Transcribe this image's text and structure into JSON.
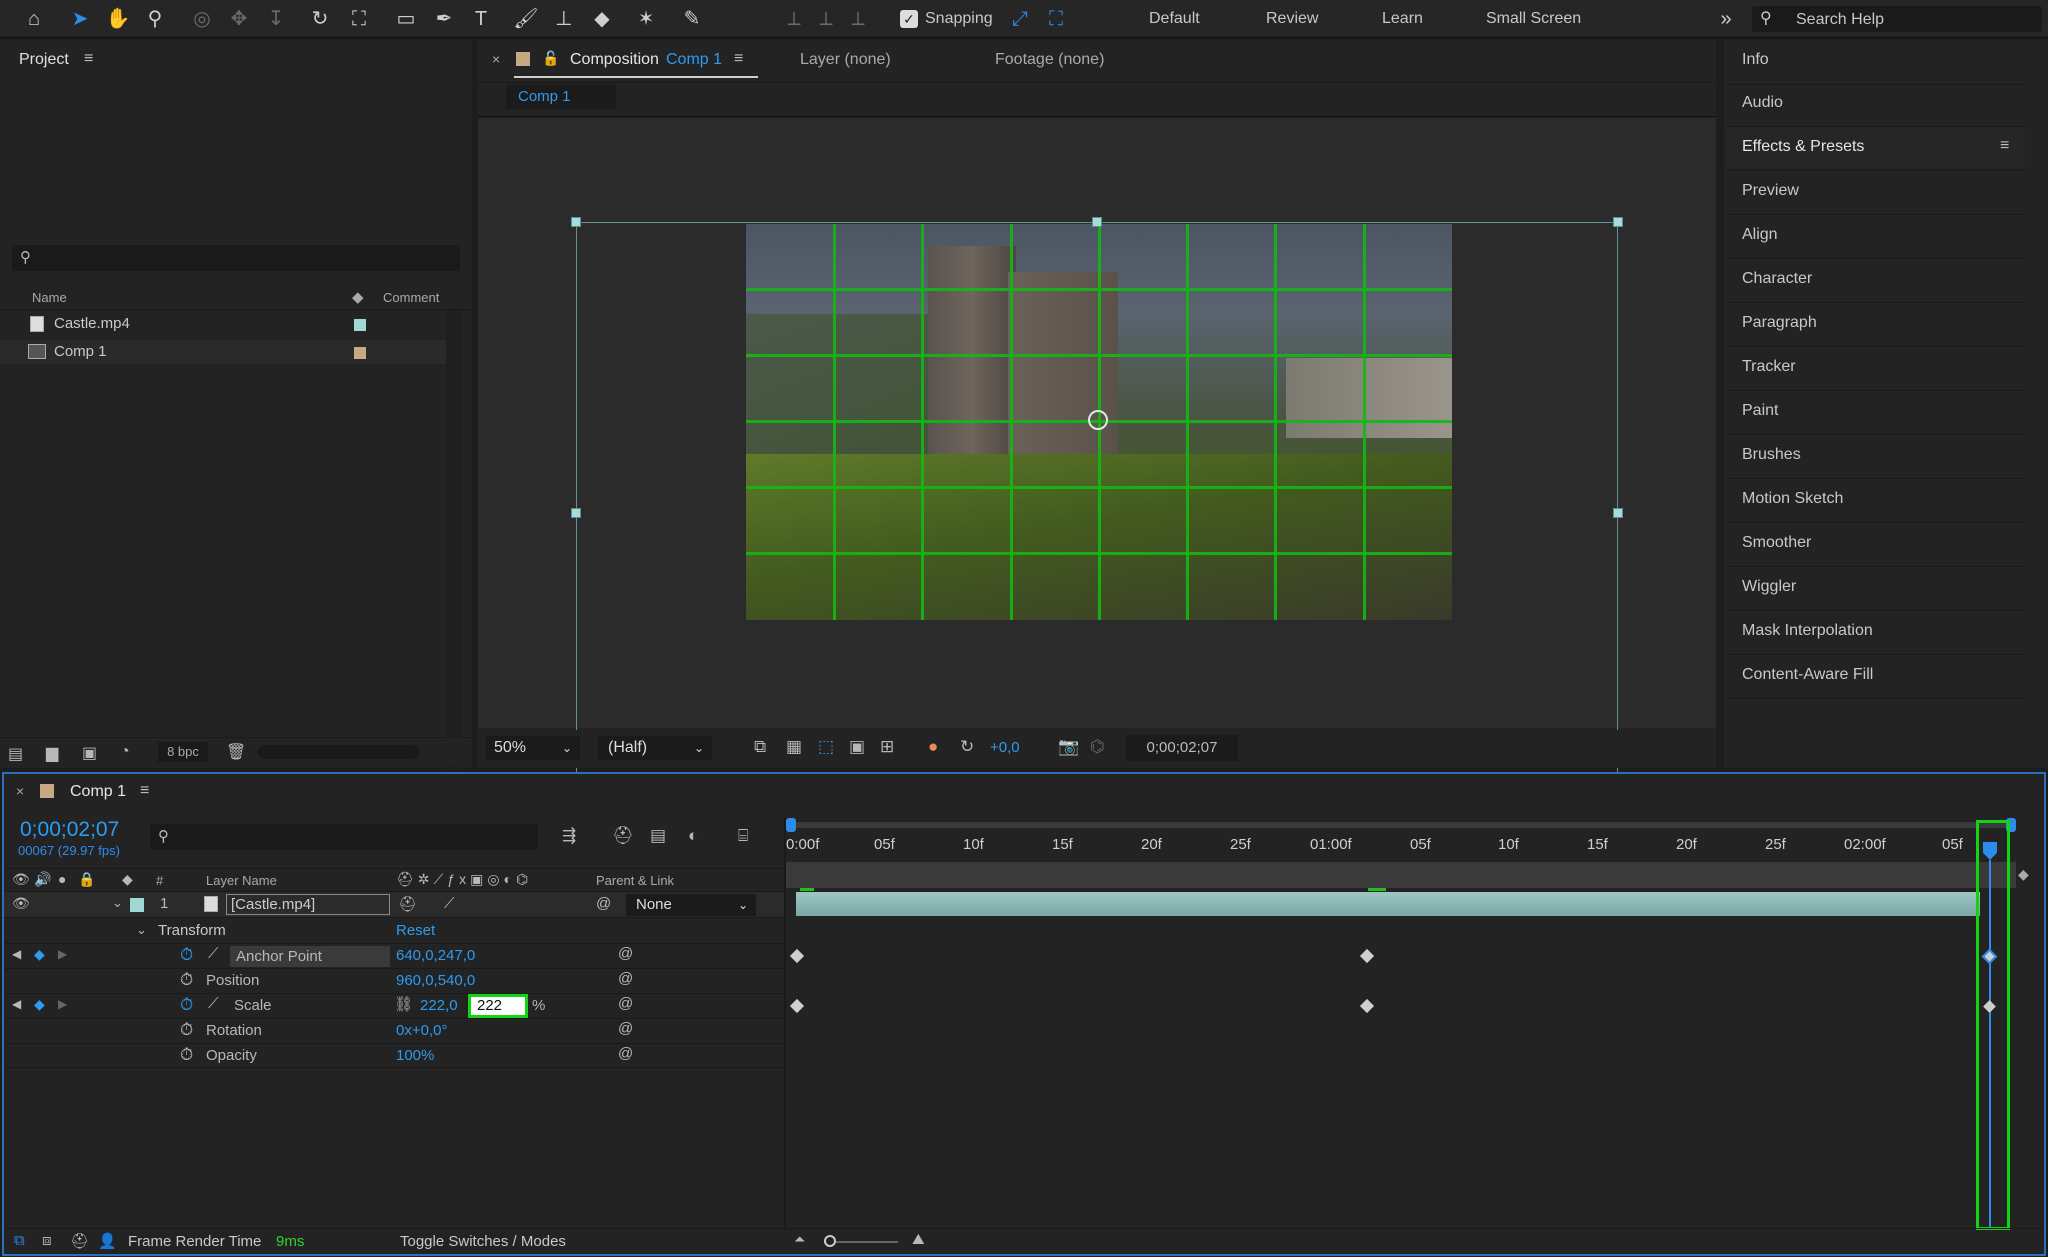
{
  "toolbar": {
    "snapping_label": "Snapping",
    "workspaces": [
      "Default",
      "Review",
      "Learn",
      "Small Screen"
    ],
    "search_placeholder": "Search Help"
  },
  "project": {
    "title": "Project",
    "col_name": "Name",
    "col_comment": "Comment",
    "items": [
      {
        "name": "Castle.mp4",
        "color": "#a0d8d8"
      },
      {
        "name": "Comp 1",
        "color": "#c8a882"
      }
    ],
    "bpc": "8 bpc"
  },
  "viewer": {
    "tab_prefix": "Composition",
    "tab_comp": "Comp 1",
    "layer_tab": "Layer (none)",
    "footage_tab": "Footage (none)",
    "breadcrumb": "Comp 1",
    "zoom": "50%",
    "resolution": "(Half)",
    "exposure": "+0,0",
    "timecode": "0;00;02;07"
  },
  "right_panel": {
    "items": [
      "Info",
      "Audio",
      "Effects & Presets",
      "Preview",
      "Align",
      "Character",
      "Paragraph",
      "Tracker",
      "Paint",
      "Brushes",
      "Motion Sketch",
      "Smoother",
      "Wiggler",
      "Mask Interpolation",
      "Content-Aware Fill"
    ]
  },
  "timeline": {
    "comp_name": "Comp 1",
    "timecode": "0;00;02;07",
    "frame_info": "00067 (29.97 fps)",
    "col_num": "#",
    "col_layer_name": "Layer Name",
    "col_parent": "Parent & Link",
    "layer": {
      "index": "1",
      "name": "[Castle.mp4]",
      "parent": "None"
    },
    "transform_label": "Transform",
    "reset_label": "Reset",
    "props": [
      {
        "name": "Anchor Point",
        "value": "640,0,247,0"
      },
      {
        "name": "Position",
        "value": "960,0,540,0"
      },
      {
        "name": "Scale",
        "value": "222,0",
        "edit": "222",
        "unit": "%"
      },
      {
        "name": "Rotation",
        "value": "0x+0,0°"
      },
      {
        "name": "Opacity",
        "value": "100%"
      }
    ],
    "ruler_ticks": [
      "0:00f",
      "05f",
      "10f",
      "15f",
      "20f",
      "25f",
      "01:00f",
      "05f",
      "10f",
      "15f",
      "20f",
      "25f",
      "02:00f",
      "05f"
    ],
    "footer_render_label": "Frame Render Time",
    "footer_render_value": "9ms",
    "footer_toggle": "Toggle Switches / Modes"
  }
}
